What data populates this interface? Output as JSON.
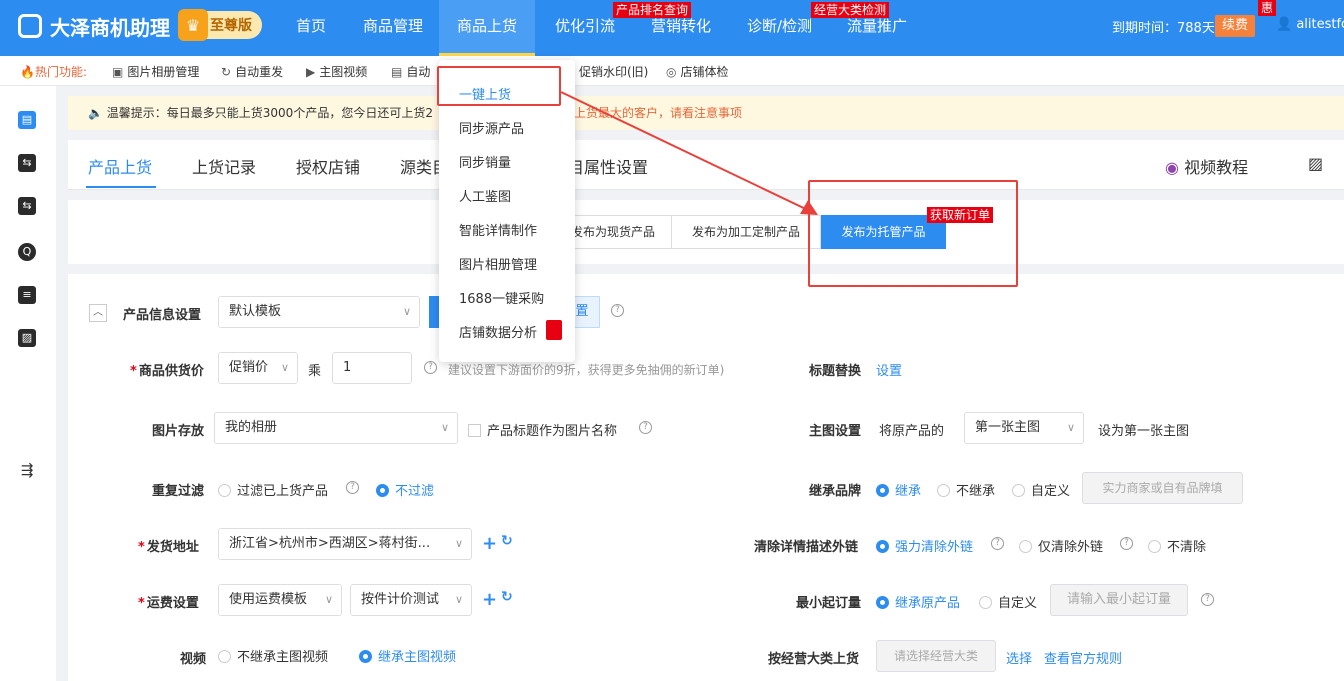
{
  "brand": {
    "title": "大泽商机助理",
    "badge": "至尊版"
  },
  "nav": {
    "items": [
      "首页",
      "商品管理",
      "商品上货",
      "优化引流",
      "营销转化",
      "诊断/检测",
      "流量推广"
    ],
    "active": "商品上货",
    "tags": [
      "产品排名查询",
      "经营大类检测",
      "惠"
    ]
  },
  "header_right": {
    "expire": "到期时间：788天",
    "renew": "续费",
    "user": "alitestfori"
  },
  "quick": {
    "label": "热门功能:",
    "items": [
      "图片相册管理",
      "自动重发",
      "主图视频",
      "自动",
      "促销水印(旧)",
      "店铺体检"
    ]
  },
  "notice": {
    "text": "温馨提示：每日最多只能上货3000个产品，您今日还可上货2",
    "text2": "上货最大的客户，请看注意事项"
  },
  "tabs": {
    "items": [
      "产品上货",
      "上货记录",
      "授权店铺",
      "源类目",
      "目属性设置"
    ],
    "video": "视频教程"
  },
  "publish": {
    "buttons": [
      "发布为现货产品",
      "发布为加工定制产品",
      "发布为托管产品"
    ],
    "tag": "获取新订单"
  },
  "dropdown": {
    "items": [
      "一键上货",
      "同步源产品",
      "同步销量",
      "人工鉴图",
      "智能详情制作",
      "图片相册管理",
      "1688一键采购",
      "店铺数据分析"
    ]
  },
  "form": {
    "product_info": {
      "label": "产品信息设置",
      "template": "默认模板",
      "setting": "置"
    },
    "supply_price": {
      "label": "商品供货价",
      "type": "促销价",
      "mult_label": "乘",
      "mult": "1",
      "hint": "建议设置下游面价的9折，获得更多免抽佣的新订单)"
    },
    "title_replace": {
      "label": "标题替换",
      "link": "设置"
    },
    "image_store": {
      "label": "图片存放",
      "album": "我的相册",
      "checkbox": "产品标题作为图片名称"
    },
    "main_image": {
      "label": "主图设置",
      "prefix": "将原产品的",
      "value": "第一张主图",
      "suffix": "设为第一张主图"
    },
    "dup_filter": {
      "label": "重复过滤",
      "opt1": "过滤已上货产品",
      "opt2": "不过滤"
    },
    "brand_inherit": {
      "label": "继承品牌",
      "opt1": "继承",
      "opt2": "不继承",
      "opt3": "自定义",
      "placeholder": "实力商家或自有品牌填"
    },
    "ship_addr": {
      "label": "发货地址",
      "value": "浙江省>杭州市>西湖区>蒋村街..."
    },
    "clear_links": {
      "label": "清除详情描述外链",
      "opt1": "强力清除外链",
      "opt2": "仅清除外链",
      "opt3": "不清除"
    },
    "freight": {
      "label": "运费设置",
      "value": "使用运费模板",
      "template": "按件计价测试"
    },
    "min_order": {
      "label": "最小起订量",
      "opt1": "继承原产品",
      "opt2": "自定义",
      "placeholder": "请输入最小起订量"
    },
    "video": {
      "label": "视频",
      "opt1": "不继承主图视频",
      "opt2": "继承主图视频"
    },
    "category": {
      "label": "按经营大类上货",
      "placeholder": "请选择经营大类",
      "select": "选择",
      "rules": "查看官方规则"
    }
  }
}
